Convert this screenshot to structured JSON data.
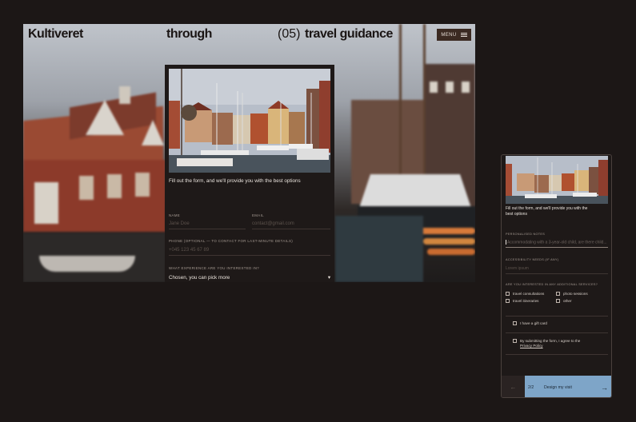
{
  "desktop": {
    "brand": "Kultiveret",
    "nav": {
      "through": "through",
      "section_number": "(05)",
      "section_title": "travel guidance"
    },
    "menu_label": "MENU",
    "form": {
      "intro": "Fill out the form, and we'll provide you with the best options",
      "name_label": "NAME",
      "name_placeholder": "Jane Doe",
      "email_label": "EMAIL",
      "email_placeholder": "contact@gmail.com",
      "phone_label": "PHONE (OPTIONAL — TO CONTACT FOR LAST-MINUTE DETAILS)",
      "phone_placeholder": "+045 123 45 67 89",
      "experience_label": "WHAT EXPERIENCE ARE YOU INTERESTED IN?",
      "experience_value": "Chosen, you can pick more",
      "chevron": "▾"
    }
  },
  "mobile": {
    "intro": "Fill out the form, and we'll provide you with the best options",
    "notes_label": "PERSONALISED NOTES",
    "notes_value": "Accommodating with a 3-year-old child, are there child...",
    "accessibility_label": "ACCESSIBILITY NEEDS (IF ANY)",
    "accessibility_placeholder": "Lorem ipsum",
    "services_label": "ARE YOU INTERESTED IN ANY ADDITIONAL SERVICES?",
    "services": [
      "travel consultations",
      "photo sessions",
      "travel itineraries",
      "other"
    ],
    "gift_card": "I have a gift card",
    "agree_text": "By submitting the form, I agree to the",
    "privacy_link": "Privacy Policy",
    "back_arrow": "←",
    "step": "2/2",
    "cta": "Design my visit",
    "cta_arrow": "→"
  },
  "colors": {
    "background": "#1c1716",
    "panel": "#1e1918",
    "menu_button": "#3b2a22",
    "cta": "#7ea5c8"
  }
}
